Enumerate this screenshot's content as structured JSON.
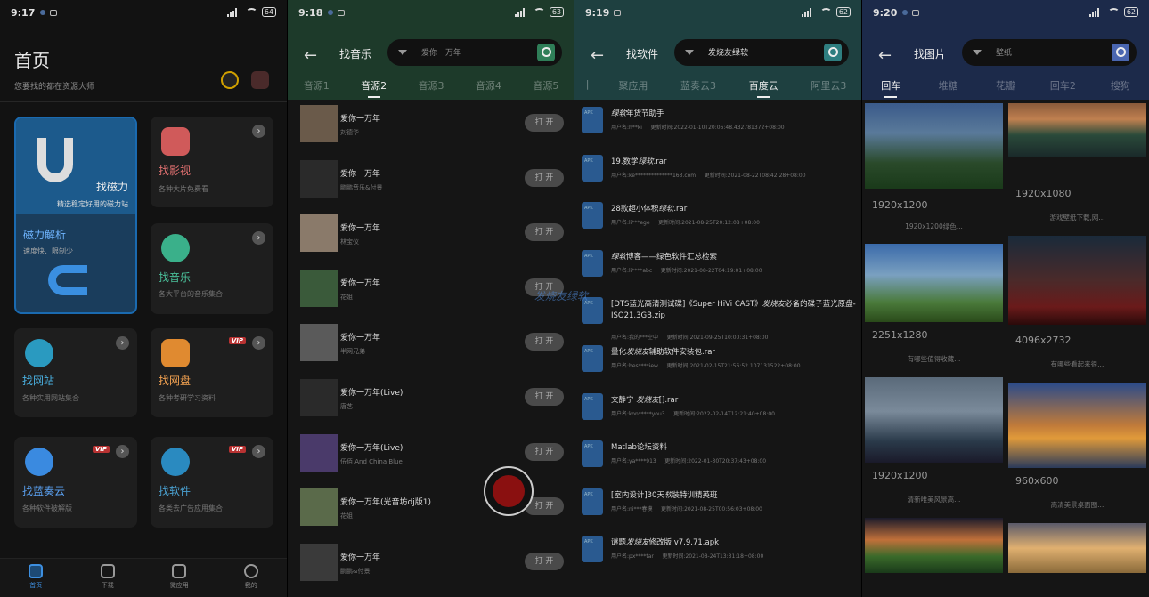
{
  "watermark": "发烧友绿软",
  "p1": {
    "status_time": "9:17",
    "battery": "64",
    "title": "首页",
    "subtitle": "您要找的都在资源大师",
    "big_card": {
      "title": "找磁力",
      "desc": "精选稳定好用的磁力站",
      "sub_title": "磁力解析",
      "sub_desc": "速度快、限制少"
    },
    "cards": [
      {
        "title": "找影视",
        "desc": "各种大片免费看",
        "color": "#d05a5a"
      },
      {
        "title": "找音乐",
        "desc": "各大平台的音乐集合",
        "color": "#3ab08a"
      },
      {
        "title": "找网站",
        "desc": "各种实用网站集合",
        "color": "#2a9ac0"
      },
      {
        "title": "找网盘",
        "desc": "各种考研学习资料",
        "color": "#e08a30",
        "vip": "VIP"
      },
      {
        "title": "找蓝奏云",
        "desc": "各种软件破解版",
        "color": "#3a8ae0",
        "vip": "VIP"
      },
      {
        "title": "找软件",
        "desc": "各类去广告应用集合",
        "color": "#2a8ac0",
        "vip": "VIP"
      }
    ],
    "nav": [
      "首页",
      "下载",
      "微应用",
      "我的"
    ]
  },
  "p2": {
    "status_time": "9:18",
    "battery": "63",
    "title": "找音乐",
    "search_value": "爱你一万年",
    "tabs": [
      "音源1",
      "音源2",
      "音源3",
      "音源4",
      "音源5"
    ],
    "play_label": "打 开",
    "songs": [
      {
        "name": "爱你一万年",
        "artist": "刘德华"
      },
      {
        "name": "爱你一万年",
        "artist": "鹏鹏音乐&付景"
      },
      {
        "name": "爱你一万年",
        "artist": "林宝仪"
      },
      {
        "name": "爱你一万年",
        "artist": "花姐"
      },
      {
        "name": "爱你一万年",
        "artist": "半网兄弟"
      },
      {
        "name": "爱你一万年(Live)",
        "artist": "唐艺"
      },
      {
        "name": "爱你一万年(Live)",
        "artist": "伍佰 And China Blue"
      },
      {
        "name": "爱你一万年(光音坊dj版1)",
        "artist": "花姐"
      },
      {
        "name": "爱你一万年",
        "artist": "鹏鹏&付景"
      }
    ]
  },
  "p3": {
    "status_time": "9:19",
    "battery": "62",
    "title": "找软件",
    "search_value": "发烧友绿软",
    "tabs": [
      "|",
      "聚应用",
      "蓝奏云3",
      "百度云",
      "阿里云3"
    ],
    "files": [
      {
        "pre": "",
        "em": "绿软",
        "post": "年货节助手",
        "user": "用户名:h**ki",
        "time": "更新时间:2022-01-10T20:06:48.432781372+08:00"
      },
      {
        "pre": "19.数学",
        "em": "绿软",
        "post": ".rar",
        "user": "用户名:ke**************163.com",
        "time": "更新时间:2021-08-22T08:42:28+08:00"
      },
      {
        "pre": "28款超小体积",
        "em": "绿软",
        "post": ".rar",
        "user": "用户名:li***ege",
        "time": "更新时间:2021-08-25T20:12:08+08:00"
      },
      {
        "pre": "",
        "em": "绿软",
        "post": "博客——绿色软件汇总检索",
        "user": "用户名:li****abc",
        "time": "更新时间:2021-08-22T04:19:01+08:00"
      },
      {
        "pre": "[DTS蓝光高清测试碟]《Super HiVi CAST》",
        "em": "发烧友",
        "post": "必备的碟子蓝光原盘-ISO21.3GB.zip",
        "user": "用户名:我的***空中",
        "time": "更新时间:2021-09-25T10:00:31+08:00",
        "tall": true
      },
      {
        "pre": "量化",
        "em": "发烧友",
        "post": "辅助软件安装包.rar",
        "user": "用户名:bes****iew",
        "time": "更新时间:2021-02-15T21:56:52.107131522+08:00"
      },
      {
        "pre": "文静宁 ",
        "em": "发烧友",
        "post": "[].rar",
        "user": "用户名:kon*****you3",
        "time": "更新时间:2022-02-14T12:21:40+08:00"
      },
      {
        "pre": "Matlab论坛资料",
        "em": "",
        "post": "",
        "user": "用户名:ya****913",
        "time": "更新时间:2022-01-30T20:37:43+08:00"
      },
      {
        "pre": "[室内设计]30天",
        "em": "软",
        "post": "装特训精英班",
        "user": "用户名:ni***春漠",
        "time": "更新时间:2021-08-25T00:56:03+08:00"
      },
      {
        "pre": "谜题",
        "em": "发烧友",
        "post": "修改版 v7.9.71.apk",
        "user": "用户名:px****tar",
        "time": "更新时间:2021-08-24T13:31:18+08:00"
      }
    ]
  },
  "p4": {
    "status_time": "9:20",
    "battery": "62",
    "title": "找图片",
    "search_value": "壁纸",
    "tabs": [
      "回车",
      "堆糖",
      "花瓣",
      "回车2",
      "搜狗"
    ],
    "images": [
      {
        "res": "1920x1200",
        "cap": "1920x1200绿色...",
        "grad": "linear-gradient(180deg,#3a5a8a 0%,#5a7a9a 35%,#2a4a2a 70%,#1a3a1a 100%)"
      },
      {
        "res": "1920x1080",
        "cap": "游戏壁纸下载,网...",
        "grad": "linear-gradient(180deg,#8a5a3a 0%,#c08050 30%,#2a4a3a 60%,#1a2a2a 100%)"
      },
      {
        "res": "2251x1280",
        "cap": "有哪些值得收藏...",
        "grad": "linear-gradient(180deg,#3a6aaa 0%,#7aa0c0 40%,#4a7a3a 75%,#2a4a1a 100%)"
      },
      {
        "res": "4096x2732",
        "cap": "有哪些看起来很...",
        "grad": "linear-gradient(180deg,#1a2a3a 0%,#4a2a2a 50%,#6a1a1a 80%,#2a0a0a 100%)"
      },
      {
        "res": "1920x1200",
        "cap": "清新唯美风景高...",
        "grad": "linear-gradient(180deg,#5a6a7a 0%,#7a8a9a 40%,#2a3a4a 75%,#1a1a2a 100%)"
      },
      {
        "res": "960x600",
        "cap": "高清美景桌面图...",
        "grad": "linear-gradient(180deg,#2a4a8a 0%,#c07a3a 50%,#e09a3a 65%,#2a3a5a 100%)"
      },
      {
        "res": "",
        "cap": "",
        "grad": "linear-gradient(180deg,#1a1a2a 0%,#c0703a 40%,#3a6a2a 70%,#1a3a1a 100%)"
      },
      {
        "res": "",
        "cap": "",
        "grad": "linear-gradient(180deg,#5a5a6a 0%,#e0b070 50%,#8a6a3a 100%)"
      }
    ]
  }
}
